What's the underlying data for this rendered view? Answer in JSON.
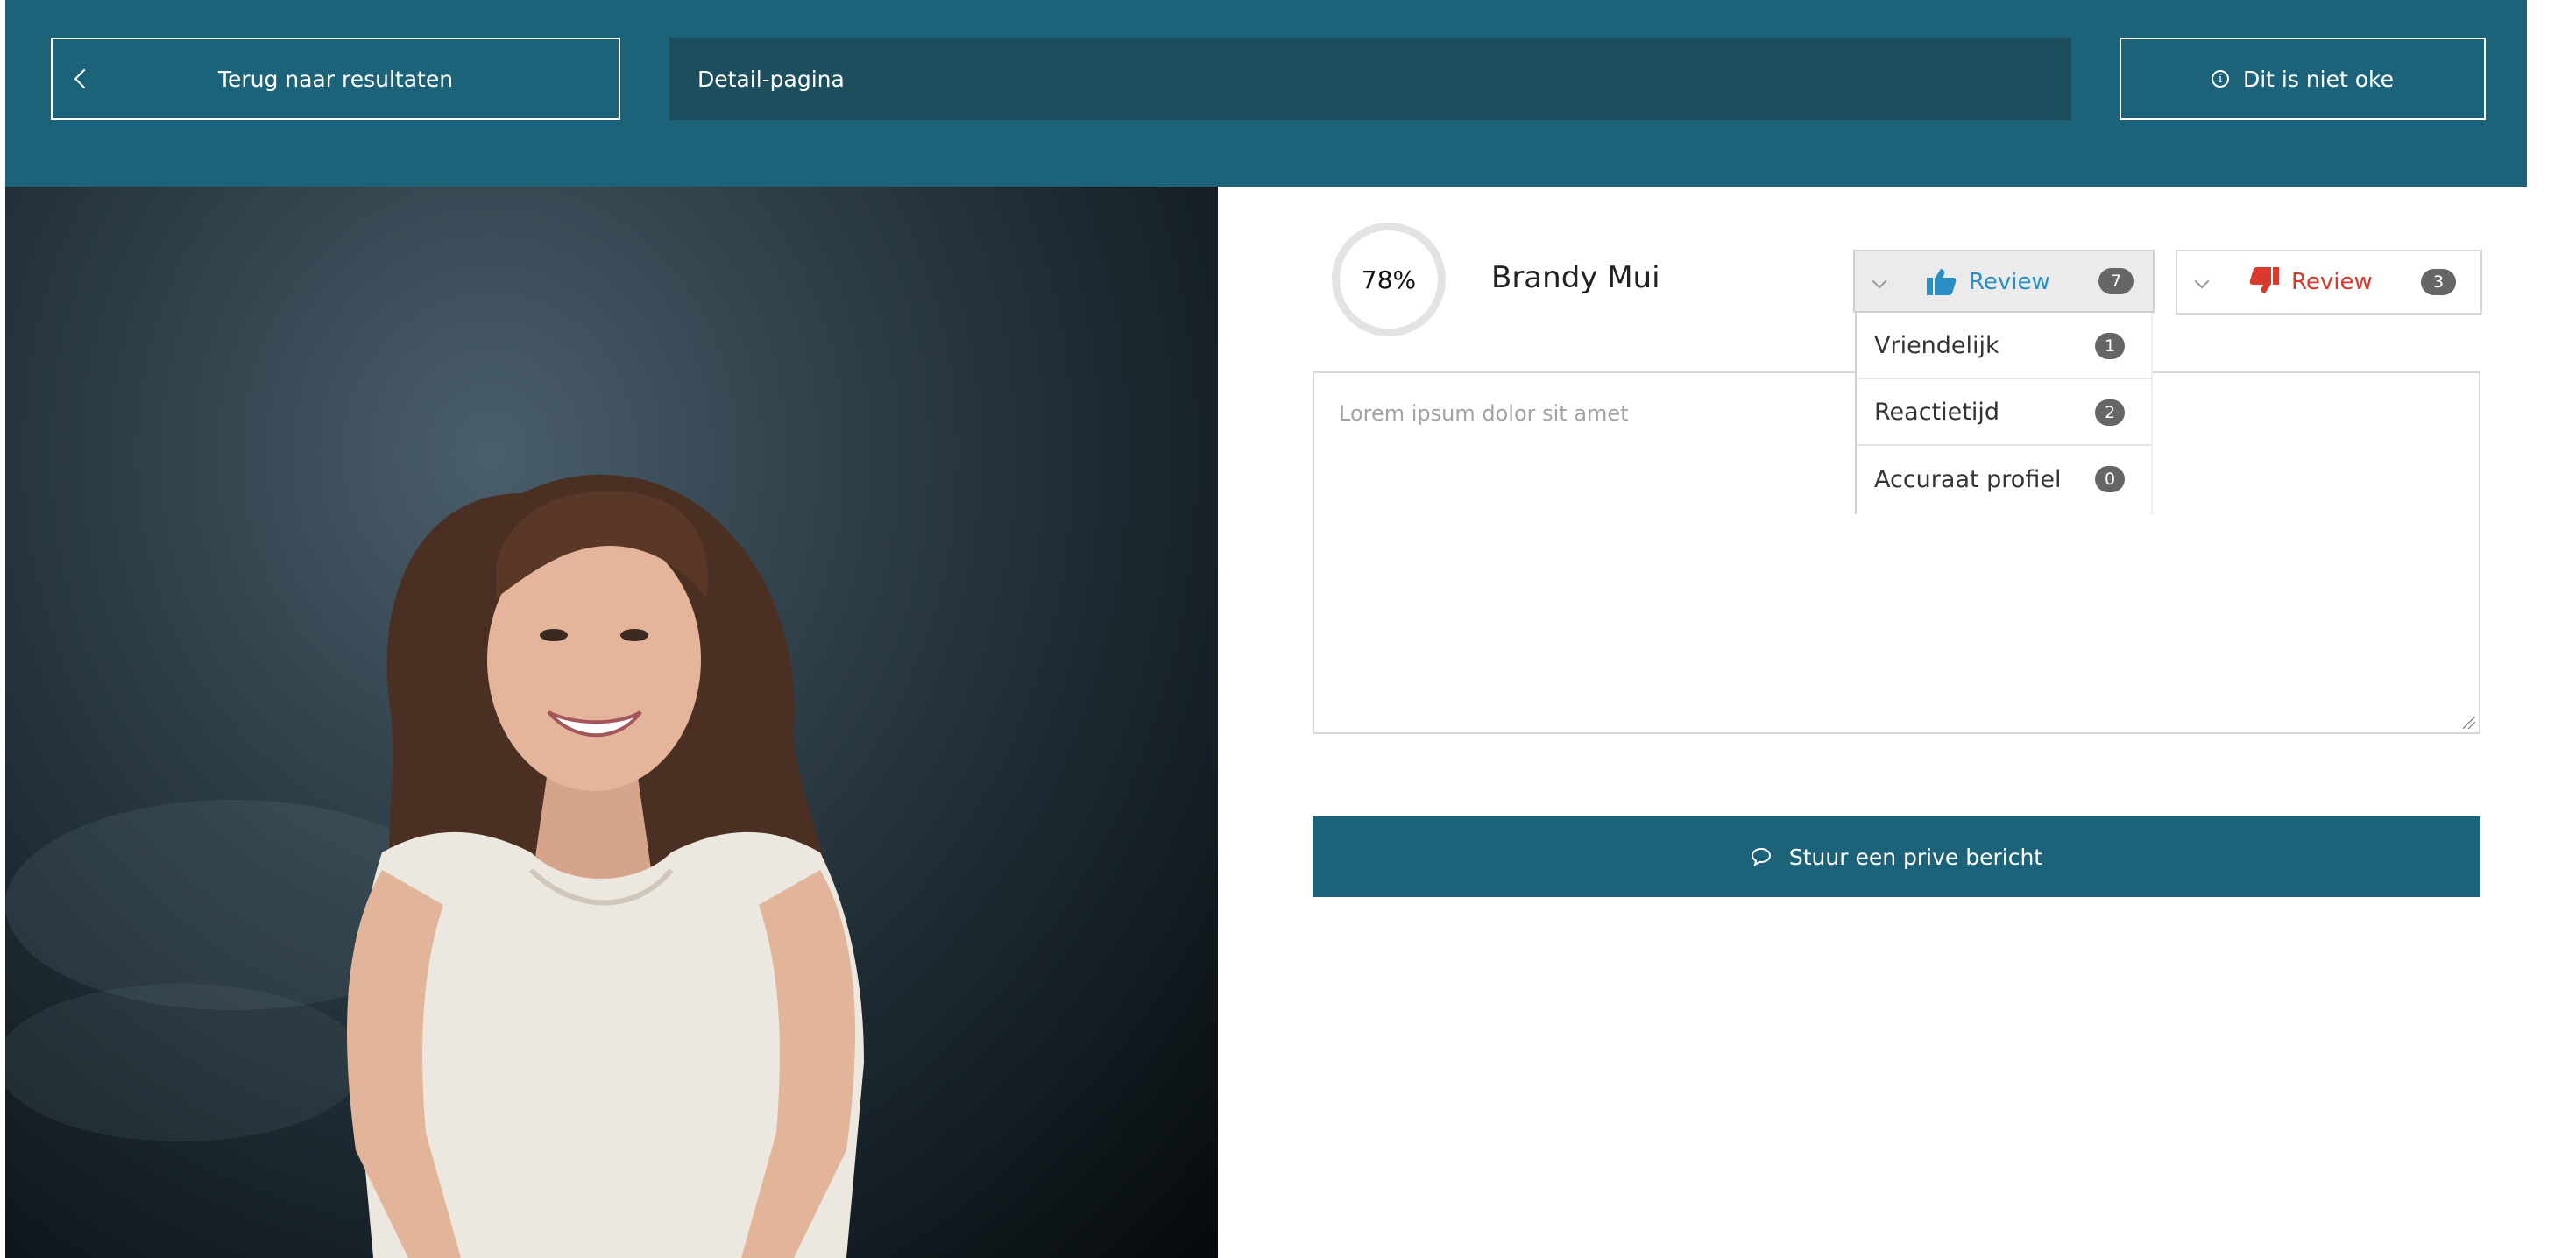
{
  "header": {
    "back_label": "Terug naar resultaten",
    "page_title": "Detail-pagina",
    "report_label": "Dit is niet oke"
  },
  "profile": {
    "rating": "78%",
    "name": "Brandy Mui"
  },
  "reviews": {
    "positive": {
      "label": "Review",
      "count": "7",
      "color": "#2a8fc2",
      "icon": "thumbs-up-icon"
    },
    "negative": {
      "label": "Review",
      "count": "3",
      "color": "#d83a2e",
      "icon": "thumbs-down-icon"
    }
  },
  "dropdown": {
    "items": [
      {
        "label": "Vriendelijk",
        "count": "1"
      },
      {
        "label": "Reactietijd",
        "count": "2"
      },
      {
        "label": "Accuraat profiel",
        "count": "0"
      }
    ]
  },
  "message": {
    "placeholder": "Lorem ipsum dolor sit amet"
  },
  "send": {
    "label": "Stuur een prive bericht"
  },
  "colors": {
    "primary": "#1c6379",
    "title_field": "#1c4e5e"
  }
}
